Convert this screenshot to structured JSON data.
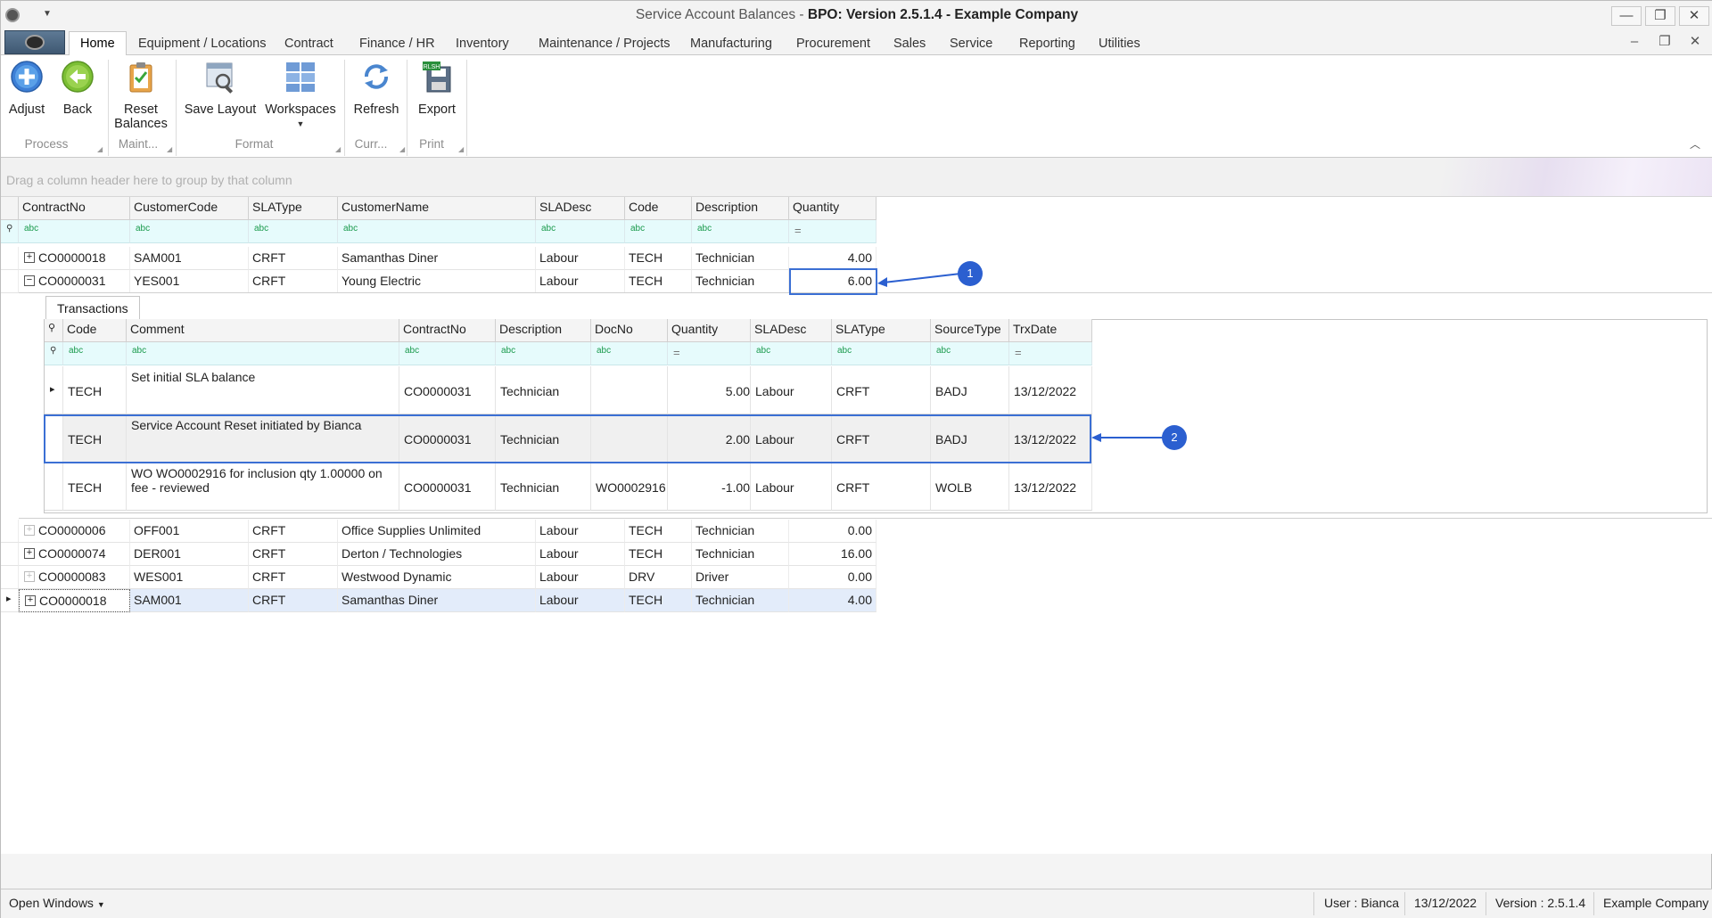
{
  "window": {
    "title_prefix": "Service Account Balances - ",
    "title_bold": "BPO: Version 2.5.1.4 - Example Company"
  },
  "menu": {
    "tabs": [
      "Home",
      "Equipment / Locations",
      "Contract",
      "Finance / HR",
      "Inventory",
      "Maintenance / Projects",
      "Manufacturing",
      "Procurement",
      "Sales",
      "Service",
      "Reporting",
      "Utilities"
    ]
  },
  "ribbon": {
    "adjust": "Adjust",
    "back": "Back",
    "reset": "Reset",
    "balances": "Balances",
    "save_layout": "Save Layout",
    "workspaces": "Workspaces",
    "refresh": "Refresh",
    "export": "Export",
    "export_badge": "RLSH",
    "groups": {
      "process": "Process",
      "maint": "Maint...",
      "format": "Format",
      "curr": "Curr...",
      "print": "Print"
    }
  },
  "group_hint": "Drag a column header here to group by that column",
  "grid": {
    "headers": [
      "ContractNo",
      "CustomerCode",
      "SLAType",
      "CustomerName",
      "SLADesc",
      "Code",
      "Description",
      "Quantity"
    ],
    "filter_icon": "abc",
    "filter_eq": "=",
    "rows_top": [
      [
        "CO0000018",
        "SAM001",
        "CRFT",
        "Samanthas Diner",
        "Labour",
        "TECH",
        "Technician",
        "4.00"
      ],
      [
        "CO0000031",
        "YES001",
        "CRFT",
        "Young Electric",
        "Labour",
        "TECH",
        "Technician",
        "6.00"
      ]
    ],
    "rows_bottom": [
      [
        "CO0000006",
        "OFF001",
        "CRFT",
        "Office Supplies Unlimited",
        "Labour",
        "TECH",
        "Technician",
        "0.00"
      ],
      [
        "CO0000074",
        "DER001",
        "CRFT",
        "Derton / Technologies",
        "Labour",
        "TECH",
        "Technician",
        "16.00"
      ],
      [
        "CO0000083",
        "WES001",
        "CRFT",
        "Westwood Dynamic",
        "Labour",
        "DRV",
        "Driver",
        "0.00"
      ],
      [
        "CO0000018",
        "SAM001",
        "CRFT",
        "Samanthas Diner",
        "Labour",
        "TECH",
        "Technician",
        "4.00"
      ]
    ]
  },
  "detail": {
    "tab": "Transactions",
    "headers": [
      "Code",
      "Comment",
      "ContractNo",
      "Description",
      "DocNo",
      "Quantity",
      "SLADesc",
      "SLAType",
      "SourceType",
      "TrxDate"
    ],
    "rows": [
      [
        "TECH",
        "Set initial SLA balance",
        "CO0000031",
        "Technician",
        "",
        "5.00",
        "Labour",
        "CRFT",
        "BADJ",
        "13/12/2022"
      ],
      [
        "TECH",
        "Service Account Reset initiated by Bianca",
        "CO0000031",
        "Technician",
        "",
        "2.00",
        "Labour",
        "CRFT",
        "BADJ",
        "13/12/2022"
      ],
      [
        "TECH",
        "WO WO0002916 for inclusion qty 1.00000 on fee - reviewed",
        "CO0000031",
        "Technician",
        "WO0002916",
        "-1.00",
        "Labour",
        "CRFT",
        "WOLB",
        "13/12/2022"
      ]
    ]
  },
  "callouts": [
    "1",
    "2"
  ],
  "status": {
    "open_windows": "Open Windows",
    "user": "User : Bianca",
    "date": "13/12/2022",
    "version": "Version : 2.5.1.4",
    "company": "Example Company"
  },
  "colors": {
    "accent": "#2b5fd0",
    "filter_bg": "#e6fbfc",
    "selected_row": "#e3ecfa"
  }
}
